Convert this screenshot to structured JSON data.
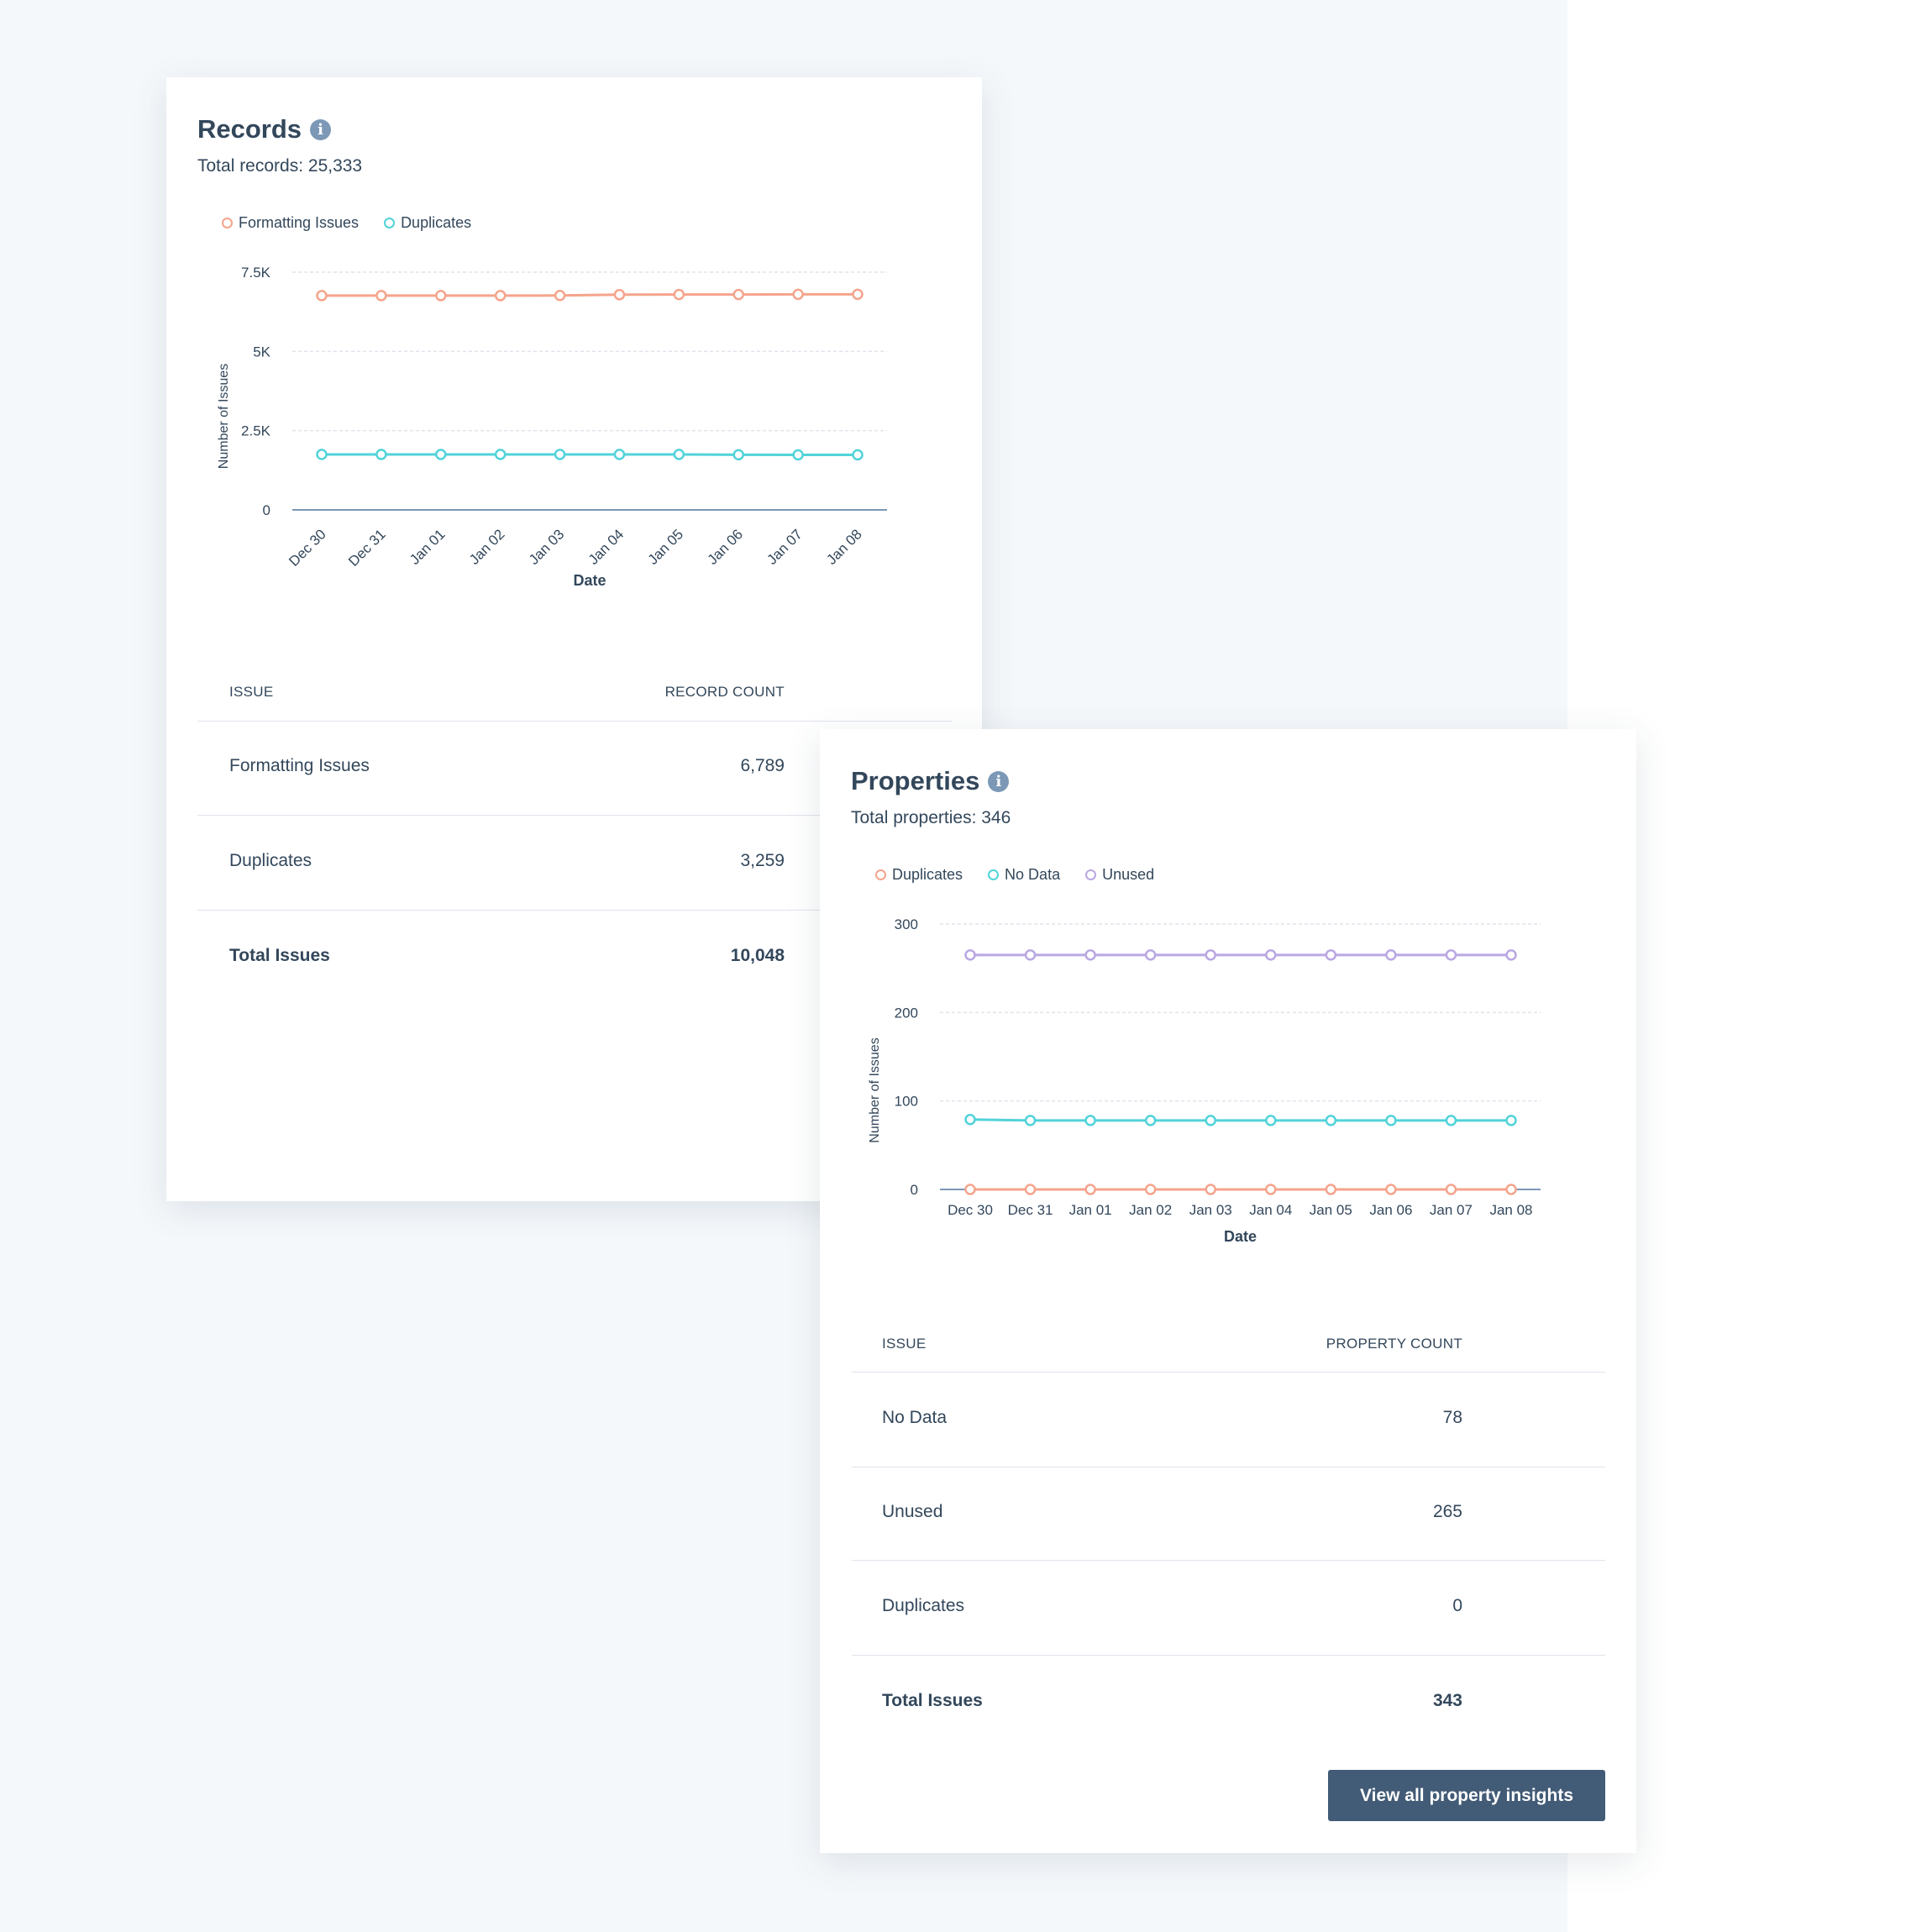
{
  "records": {
    "title": "Records",
    "subtitle": "Total records: 25,333",
    "table": {
      "headers": [
        "Issue",
        "Record Count"
      ],
      "rows": [
        {
          "issue": "Formatting Issues",
          "count": "6,789"
        },
        {
          "issue": "Duplicates",
          "count": "3,259"
        }
      ],
      "total": {
        "issue": "Total Issues",
        "count": "10,048"
      }
    }
  },
  "properties": {
    "title": "Properties",
    "subtitle": "Total properties: 346",
    "table": {
      "headers": [
        "Issue",
        "Property Count"
      ],
      "rows": [
        {
          "issue": "No Data",
          "count": "78"
        },
        {
          "issue": "Unused",
          "count": "265"
        },
        {
          "issue": "Duplicates",
          "count": "0"
        }
      ],
      "total": {
        "issue": "Total Issues",
        "count": "343"
      }
    },
    "button_label": "View all property insights"
  },
  "icons": {
    "info": "info-icon"
  },
  "colors": {
    "orange": "#f5a48c",
    "teal": "#51d3d9",
    "purple": "#b9a7e3",
    "button": "#425b76"
  },
  "chart_data": [
    {
      "type": "line",
      "xlabel": "Date",
      "ylabel": "Number of Issues",
      "x": [
        "Dec 30",
        "Dec 31",
        "Jan 01",
        "Jan 02",
        "Jan 03",
        "Jan 04",
        "Jan 05",
        "Jan 06",
        "Jan 07",
        "Jan 08"
      ],
      "yticks": [
        "0",
        "2.5K",
        "5K",
        "7.5K"
      ],
      "ylim": [
        0,
        7500
      ],
      "grid": true,
      "legend": "top-left",
      "x_rotated": true,
      "series": [
        {
          "name": "Formatting Issues",
          "color": "#f5a48c",
          "values": [
            6760,
            6760,
            6760,
            6760,
            6765,
            6790,
            6795,
            6795,
            6800,
            6800
          ]
        },
        {
          "name": "Duplicates",
          "color": "#51d3d9",
          "values": [
            1750,
            1750,
            1750,
            1750,
            1750,
            1750,
            1750,
            1740,
            1735,
            1735
          ]
        }
      ]
    },
    {
      "type": "line",
      "xlabel": "Date",
      "ylabel": "Number of Issues",
      "x": [
        "Dec 30",
        "Dec 31",
        "Jan 01",
        "Jan 02",
        "Jan 03",
        "Jan 04",
        "Jan 05",
        "Jan 06",
        "Jan 07",
        "Jan 08"
      ],
      "yticks": [
        "0",
        "100",
        "200",
        "300"
      ],
      "ylim": [
        0,
        300
      ],
      "grid": true,
      "legend": "top-left",
      "x_rotated": false,
      "series": [
        {
          "name": "Duplicates",
          "color": "#f5a48c",
          "values": [
            0,
            0,
            0,
            0,
            0,
            0,
            0,
            0,
            0,
            0
          ]
        },
        {
          "name": "No Data",
          "color": "#51d3d9",
          "values": [
            79,
            78,
            78,
            78,
            78,
            78,
            78,
            78,
            78,
            78
          ]
        },
        {
          "name": "Unused",
          "color": "#b9a7e3",
          "values": [
            265,
            265,
            265,
            265,
            265,
            265,
            265,
            265,
            265,
            265
          ]
        }
      ]
    }
  ]
}
